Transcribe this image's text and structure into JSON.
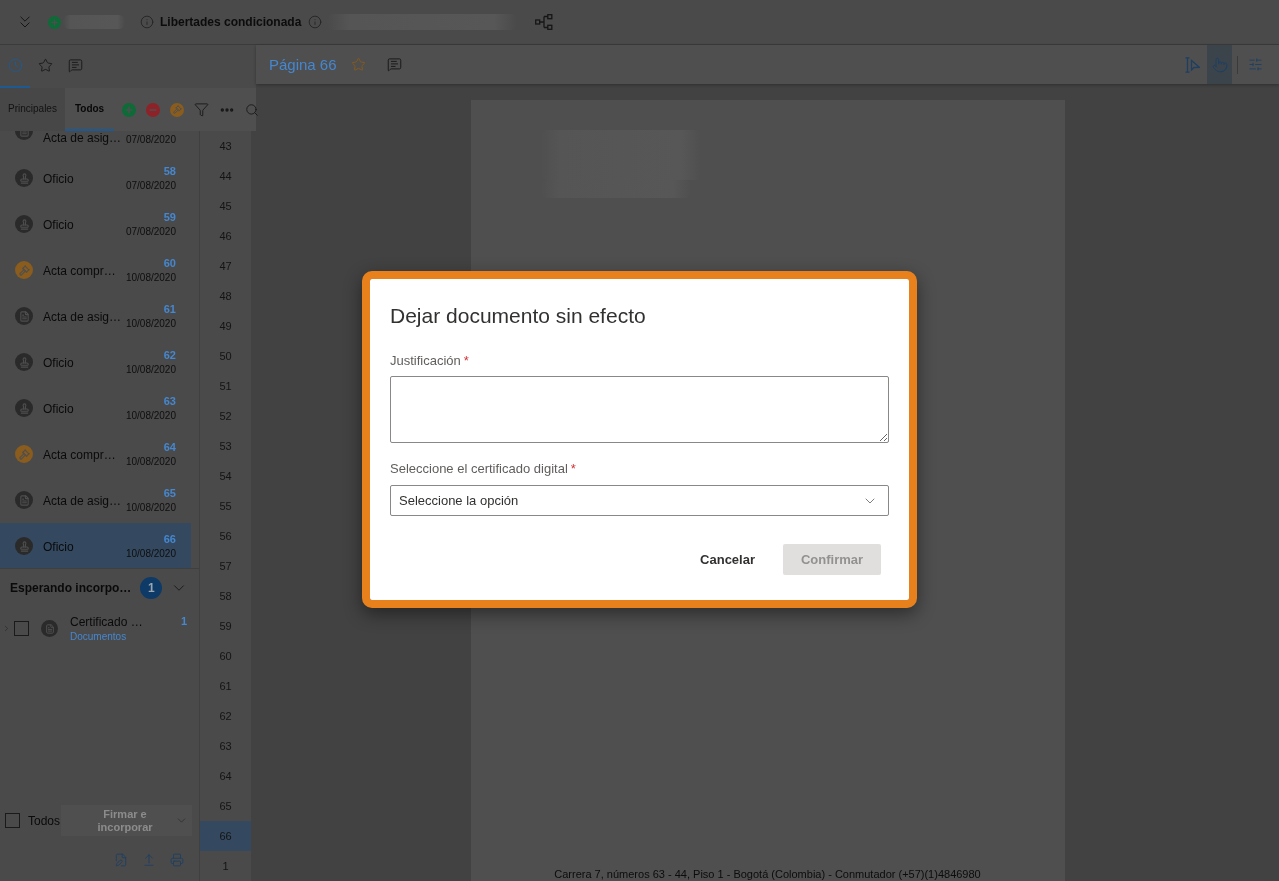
{
  "top_bar": {
    "title": "Libertades condicionada"
  },
  "side_tabs": [
    {
      "selected": true
    },
    {
      "selected": false
    },
    {
      "selected": false
    }
  ],
  "filter_tabs": [
    {
      "label": "Principales",
      "selected": false
    },
    {
      "label": "Todos",
      "selected": true
    }
  ],
  "documents": [
    {
      "name": "Acta de asig…",
      "date": "07/08/2020",
      "kind": "document",
      "selected": false
    },
    {
      "name": "Oficio",
      "number": "58",
      "date": "07/08/2020",
      "kind": "letter",
      "selected": false
    },
    {
      "name": "Oficio",
      "number": "59",
      "date": "07/08/2020",
      "kind": "letter",
      "selected": false
    },
    {
      "name": "Acta compr…",
      "number": "60",
      "date": "10/08/2020",
      "kind": "verdict",
      "selected": false
    },
    {
      "name": "Acta de asig…",
      "number": "61",
      "date": "10/08/2020",
      "kind": "document",
      "selected": false
    },
    {
      "name": "Oficio",
      "number": "62",
      "date": "10/08/2020",
      "kind": "letter",
      "selected": false
    },
    {
      "name": "Oficio",
      "number": "63",
      "date": "10/08/2020",
      "kind": "letter",
      "selected": false
    },
    {
      "name": "Acta compr…",
      "number": "64",
      "date": "10/08/2020",
      "kind": "verdict",
      "selected": false
    },
    {
      "name": "Acta de asig…",
      "number": "65",
      "date": "10/08/2020",
      "kind": "document",
      "selected": false
    },
    {
      "name": "Oficio",
      "number": "66",
      "date": "10/08/2020",
      "kind": "letter",
      "selected": true
    }
  ],
  "waiting": {
    "title": "Esperando incorpo…",
    "count": "1",
    "expanded": true,
    "items": [
      {
        "name": "Certificado …",
        "count": "1",
        "category": "Documentos",
        "kind": "document",
        "checked": false,
        "expanded": false
      }
    ]
  },
  "footer": {
    "select_all": {
      "label": "Todos",
      "checked": false
    },
    "action": {
      "label": "Firmar e incorporar",
      "disabled": true
    }
  },
  "page_numbers": [
    {
      "label": "43",
      "selected": false
    },
    {
      "label": "44",
      "selected": false
    },
    {
      "label": "45",
      "selected": false
    },
    {
      "label": "46",
      "selected": false
    },
    {
      "label": "47",
      "selected": false
    },
    {
      "label": "48",
      "selected": false
    },
    {
      "label": "49",
      "selected": false
    },
    {
      "label": "50",
      "selected": false
    },
    {
      "label": "51",
      "selected": false
    },
    {
      "label": "52",
      "selected": false
    },
    {
      "label": "53",
      "selected": false
    },
    {
      "label": "54",
      "selected": false
    },
    {
      "label": "55",
      "selected": false
    },
    {
      "label": "56",
      "selected": false
    },
    {
      "label": "57",
      "selected": false
    },
    {
      "label": "58",
      "selected": false
    },
    {
      "label": "59",
      "selected": false
    },
    {
      "label": "60",
      "selected": false
    },
    {
      "label": "61",
      "selected": false
    },
    {
      "label": "62",
      "selected": false
    },
    {
      "label": "63",
      "selected": false
    },
    {
      "label": "64",
      "selected": false
    },
    {
      "label": "65",
      "selected": false
    },
    {
      "label": "66",
      "selected": true
    },
    {
      "label": "1",
      "selected": false
    }
  ],
  "viewer": {
    "title": "Página 66",
    "favorite": false,
    "tools": [
      {
        "selected": false
      },
      {
        "selected": true
      }
    ]
  },
  "document": {
    "footer_text": "Carrera 7, números 63 - 44, Piso 1 - Bogotá (Colombia) - Conmutador (+57)(1)4846980"
  },
  "dialog": {
    "title": "Dejar documento sin efecto",
    "fields": [
      {
        "kind": "textarea",
        "label": "Justificación",
        "required_mark": "*"
      },
      {
        "kind": "select",
        "label": "Seleccione el certificado digital",
        "required_mark": "*",
        "placeholder": "Seleccione la opción"
      }
    ],
    "buttons": [
      {
        "label": "Cancelar",
        "kind": "secondary",
        "disabled": false
      },
      {
        "label": "Confirmar",
        "kind": "primary",
        "disabled": true
      }
    ]
  }
}
